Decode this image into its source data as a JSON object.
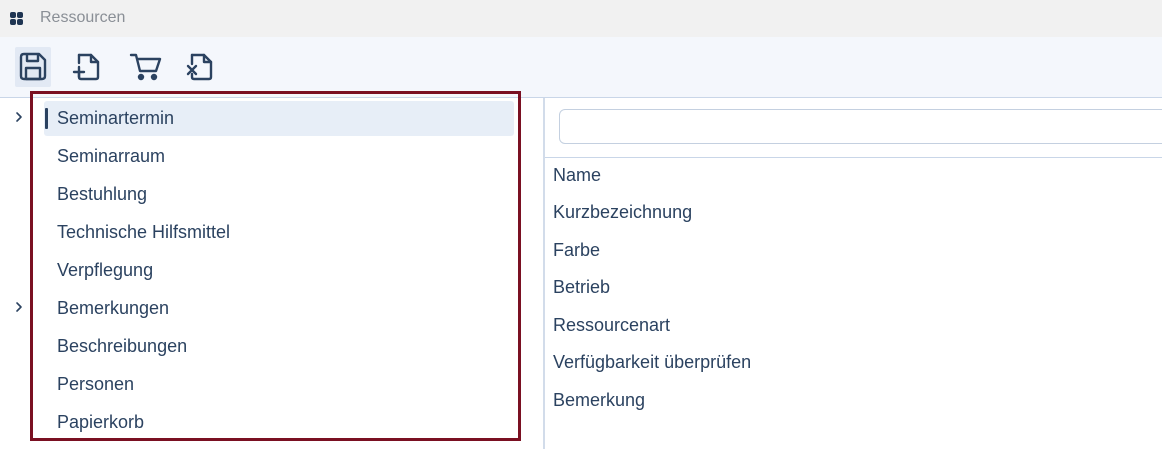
{
  "window": {
    "title": "Ressourcen"
  },
  "toolbar": {
    "buttons": [
      {
        "id": "save",
        "icon": "save-icon"
      },
      {
        "id": "new",
        "icon": "new-document-icon"
      },
      {
        "id": "cart",
        "icon": "cart-icon"
      },
      {
        "id": "delete",
        "icon": "delete-document-icon"
      }
    ]
  },
  "tree": {
    "items": [
      {
        "label": "Seminartermin",
        "selected": true,
        "expandable": true
      },
      {
        "label": "Seminarraum"
      },
      {
        "label": "Bestuhlung"
      },
      {
        "label": "Technische Hilfsmittel"
      },
      {
        "label": "Verpflegung"
      },
      {
        "label": "Bemerkungen",
        "expandable": true
      },
      {
        "label": "Beschreibungen"
      },
      {
        "label": "Personen"
      },
      {
        "label": "Papierkorb"
      }
    ]
  },
  "search": {
    "value": "",
    "placeholder": ""
  },
  "columns": {
    "items": [
      "Name",
      "Kurzbezeichnung",
      "Farbe",
      "Betrieb",
      "Ressourcenart",
      "Verfügbarkeit überprüfen",
      "Bemerkung"
    ]
  },
  "colors": {
    "accent": "#2b4260",
    "highlight_frame": "#7a1022",
    "selection_bg": "#e7eef7"
  }
}
